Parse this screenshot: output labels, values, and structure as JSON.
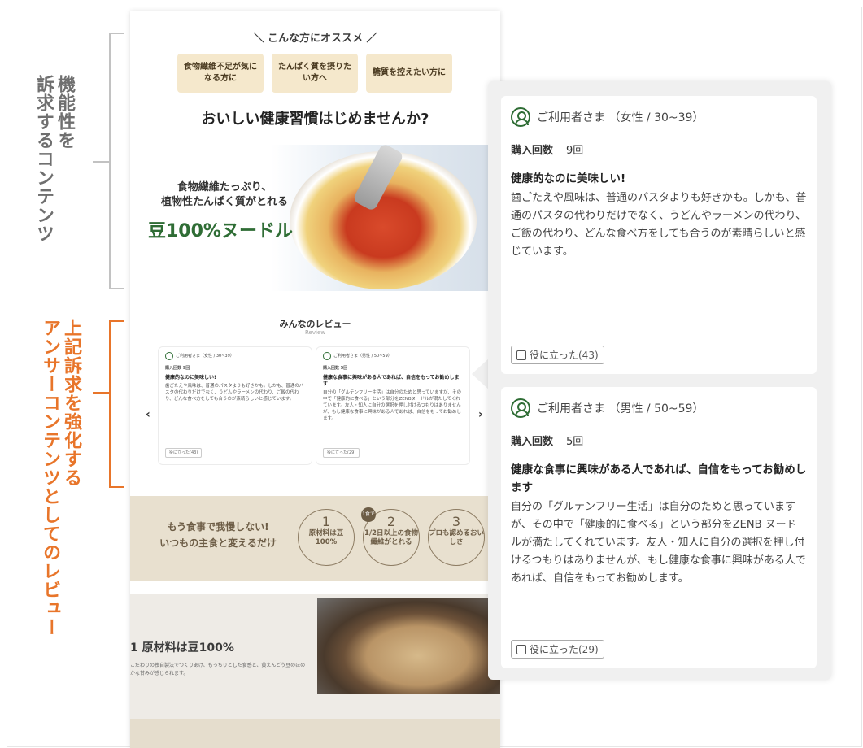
{
  "annotations": {
    "top_col1": "機能性を",
    "top_col2": "訴求するコンテンツ",
    "bottom_col1": "上記訴求を強化する",
    "bottom_col2": "アンサーコンテンツとしてのレビュー"
  },
  "page": {
    "recommend_heading": "＼ こんな方にオススメ ／",
    "recommend_boxes": [
      "食物繊維不足が気になる方に",
      "たんぱく質を摂りたい方へ",
      "糖質を控えたい方に"
    ],
    "headline": "おいしい健康習慣はじめませんか?",
    "hero_line1": "食物繊維たっぷり、",
    "hero_line2": "植物性たんぱく質がとれる",
    "hero_product": "豆100%ヌードル",
    "review_title": "みんなのレビュー",
    "review_sub": "Review",
    "mini_reviews": [
      {
        "user": "ご利用者さま（女性 / 30~39）",
        "count": "購入回数 9回",
        "title": "健康的なのに美味しい!",
        "body": "歯ごたえや風味は、普通のパスタよりも好きかも。しかも、普通のパスタの代わりだけでなく、うどんやラーメンの代わり、ご飯の代わり、どんな食べ方をしても合うのが素晴らしいと感じています。",
        "helpful": "役に立った(43)"
      },
      {
        "user": "ご利用者さま（男性 / 50~59）",
        "count": "購入回数 5回",
        "title": "健康な食事に興味がある人であれば、自信をもってお勧めします",
        "body": "自分の「グルテンフリー生活」は自分のためと思っていますが、その中で「健康的に食べる」という部分をZENBヌードルが満たしてくれています。友人・知人に自分の選択を押し付けるつもりはありませんが、もし健康な食事に興味がある人であれば、自信をもってお勧めします。",
        "helpful": "役に立った(29)"
      }
    ],
    "arrow_left": "‹",
    "arrow_right": "›",
    "band_line1": "もう食事で我慢しない!",
    "band_line2": "いつもの主食と変えるだけ",
    "badge": "1食で",
    "circles": [
      {
        "num": "1",
        "text": "原材料は豆100%"
      },
      {
        "num": "2",
        "text": "1/2日以上の食物繊維がとれる"
      },
      {
        "num": "3",
        "text": "プロも認めるおいしさ"
      }
    ],
    "feature_title": "1 原材料は豆100%",
    "feature_body": "こだわりの独自製法でつくりあげ、もっちりとした食感と、黄えんどう豆のほのかな甘みが感じられます。"
  },
  "panel": {
    "reviews": [
      {
        "user": "ご利用者さま （女性 / 30~39）",
        "count_label": "購入回数",
        "count_value": "9回",
        "title": "健康的なのに美味しい!",
        "body": "歯ごたえや風味は、普通のパスタよりも好きかも。しかも、普通のパスタの代わりだけでなく、うどんやラーメンの代わり、ご飯の代わり、どんな食べ方をしても合うのが素晴らしいと感じています。",
        "helpful": "役に立った(43)"
      },
      {
        "user": "ご利用者さま （男性 / 50~59）",
        "count_label": "購入回数",
        "count_value": "5回",
        "title": "健康な食事に興味がある人であれば、自信をもってお勧めします",
        "body": "自分の「グルテンフリー生活」は自分のためと思っていますが、その中で「健康的に食べる」という部分をZENB ヌードルが満たしてくれています。友人・知人に自分の選択を押し付けるつもりはありませんが、もし健康な食事に興味がある人であれば、自信をもってお勧めします。",
        "helpful": "役に立った(29)"
      }
    ]
  },
  "colors": {
    "accent_green": "#2f6d35",
    "annotation_orange": "#e8752a",
    "annotation_gray": "#6f6f6f",
    "recommend_box": "#f5e8cc",
    "band": "#e8e0cf"
  }
}
